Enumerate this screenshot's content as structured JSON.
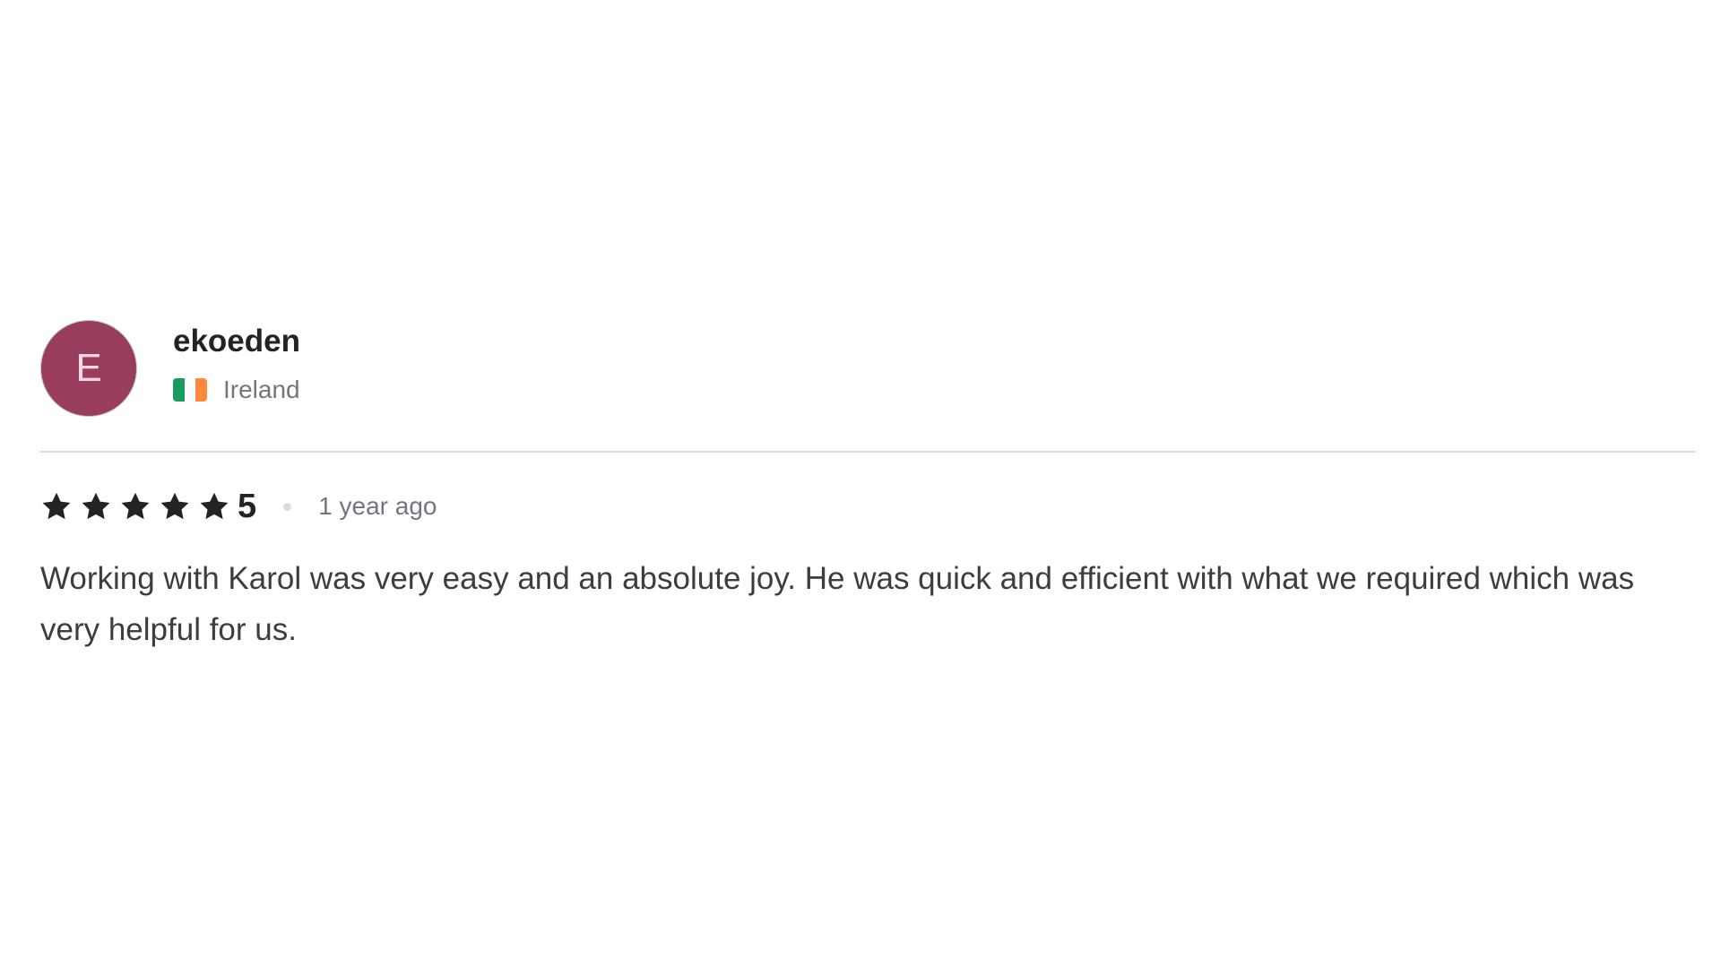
{
  "reviewer": {
    "avatar_initial": "E",
    "avatar_color": "#993d5f",
    "username": "ekoeden",
    "country": "Ireland",
    "flag_icon": "ireland-flag-icon"
  },
  "rating": {
    "stars": 5,
    "max_stars": 5,
    "score": "5",
    "time_ago": "1 year ago"
  },
  "review": {
    "text": "Working with Karol was very easy and an absolute joy. He was quick and efficient with what we required which was very helpful for us."
  }
}
